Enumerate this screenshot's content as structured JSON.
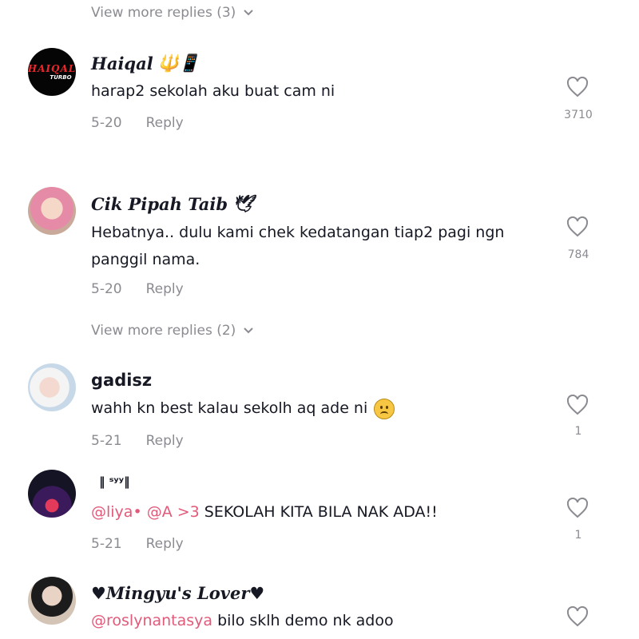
{
  "thread_top": {
    "view_more": "View more replies (3)"
  },
  "comments": [
    {
      "username": "Haiqal",
      "username_emoji": "🔱📱",
      "avatar_text": [
        "HAIQAL",
        "TURBO"
      ],
      "text": "harap2 sekolah aku buat cam ni",
      "date": "5-20",
      "reply_label": "Reply",
      "likes": "3710"
    },
    {
      "username": "Cik Pipah Taib",
      "username_emoji": "🕊",
      "text": "Hebatnya.. dulu kami chek kedatangan tiap2 pagi ngn panggil nama.",
      "date": "5-20",
      "reply_label": "Reply",
      "likes": "784",
      "view_more": "View more replies (2)"
    },
    {
      "username": "gadisz",
      "text": "wahh kn best kalau sekolh aq ade ni",
      "date": "5-21",
      "reply_label": "Reply",
      "likes": "1"
    },
    {
      "username": "‖ ˢʸʸ‖",
      "mention1": "@liya•",
      "mention2": "@A >3",
      "text": " SEKOLAH KITA BILA NAK ADA!!",
      "date": "5-21",
      "reply_label": "Reply",
      "likes": "1"
    },
    {
      "username": "♥Mingyu's Lover♥",
      "mention1": "@roslynantasya",
      "text": " bilo sklh demo nk adoo"
    }
  ],
  "colors": {
    "mention": "#e25a7a",
    "muted": "#8a8b91",
    "text": "#161823"
  },
  "icons": {
    "like": "heart-outline-icon",
    "expand": "chevron-down-icon"
  }
}
